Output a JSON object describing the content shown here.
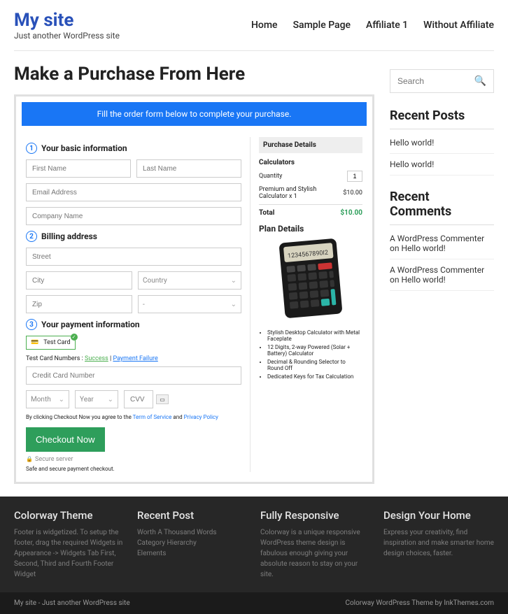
{
  "header": {
    "title": "My site",
    "tagline": "Just another WordPress site",
    "nav": [
      "Home",
      "Sample Page",
      "Affiliate 1",
      "Without Affiliate"
    ]
  },
  "page": {
    "title": "Make a Purchase From Here"
  },
  "order": {
    "banner": "Fill the order form below to complete your purchase.",
    "step1": "Your basic information",
    "step2": "Billing address",
    "step3": "Your payment information",
    "first_name_ph": "First Name",
    "last_name_ph": "Last Name",
    "email_ph": "Email Address",
    "company_ph": "Company Name",
    "street_ph": "Street",
    "city_ph": "City",
    "country_ph": "Country",
    "zip_ph": "Zip",
    "state_ph": "-",
    "card_chip": "Test  Card",
    "test_label": "Test Card Numbers : ",
    "test_success": "Success",
    "test_sep": " | ",
    "test_fail": "Payment Failure",
    "cc_ph": "Credit Card Number",
    "month_ph": "Month",
    "year_ph": "Year",
    "cvv_ph": "CVV",
    "tos_pre": "By clicking Checkout Now you agree to the ",
    "tos_link": "Term of Service",
    "tos_mid": " and ",
    "pp_link": "Privacy Policy",
    "checkout_btn": "Checkout Now",
    "secure": "Secure server",
    "secure_line": "Safe and secure payment checkout."
  },
  "details": {
    "title": "Purchase Details",
    "sub": "Calculators",
    "qty_label": "Quantity",
    "qty_val": "1",
    "item": "Premium and Stylish Calculator x 1",
    "item_price": "$10.00",
    "total_label": "Total",
    "total_val": "$10.00",
    "plan": "Plan Details",
    "bullets": [
      "Stylish Desktop Calculator with Metal Faceplate",
      "12 Digits, 2-way Powered (Solar + Battery) Calculator",
      "Decimal & Rounding Selector to Round Off",
      "Dedicated Keys for Tax Calculation"
    ]
  },
  "sidebar": {
    "search_ph": "Search",
    "recent_posts_h": "Recent Posts",
    "posts": [
      "Hello world!",
      "Hello world!"
    ],
    "recent_comments_h": "Recent Comments",
    "comments": [
      "A WordPress Commenter on Hello world!",
      "A WordPress Commenter on Hello world!"
    ]
  },
  "footer": {
    "cols": [
      {
        "h": "Colorway Theme",
        "body": "Footer is widgetized. To setup the footer, drag the required Widgets in Appearance -> Widgets Tab First, Second, Third and Fourth Footer Widget"
      },
      {
        "h": "Recent Post",
        "links": [
          "Worth A Thousand Words",
          "Category Hierarchy",
          "Elements"
        ]
      },
      {
        "h": "Fully Responsive",
        "body": "Colorway is a unique responsive WordPress theme design is fabulous enough giving your absolute reason to stay on your site."
      },
      {
        "h": "Design Your Home",
        "body": "Express your creativity, find inspiration and make smarter home design choices, faster."
      }
    ],
    "bar_left": "My site - Just another WordPress site",
    "bar_right": "Colorway WordPress Theme by InkThemes.com"
  }
}
